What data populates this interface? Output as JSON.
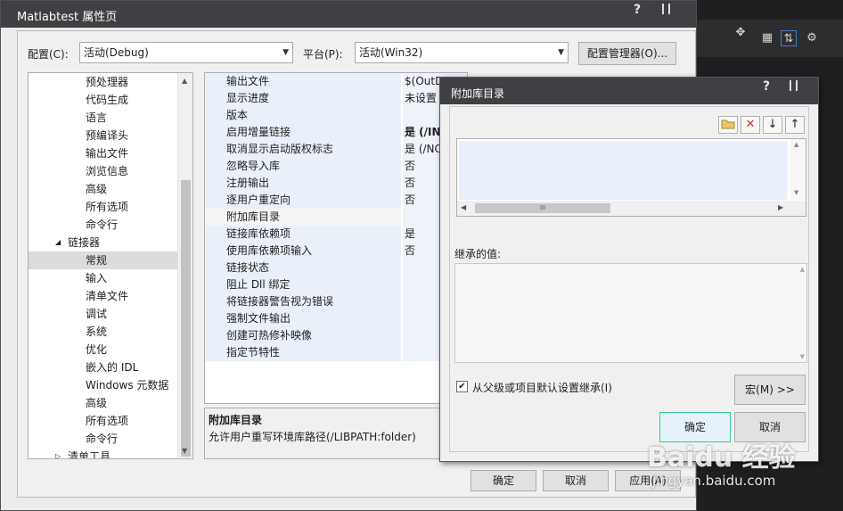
{
  "main_window": {
    "title": "Matlabtest 属性页",
    "help_glyph": "?",
    "config_label": "配置(C):",
    "config_value": "活动(Debug)",
    "platform_label": "平台(P):",
    "platform_value": "活动(Win32)",
    "config_manager_button": "配置管理器(O)...",
    "ok_button": "确定",
    "cancel_button": "取消",
    "apply_button": "应用(A)"
  },
  "tree": {
    "items": [
      {
        "label": "预处理器"
      },
      {
        "label": "代码生成"
      },
      {
        "label": "语言"
      },
      {
        "label": "预编译头"
      },
      {
        "label": "输出文件"
      },
      {
        "label": "浏览信息"
      },
      {
        "label": "高级"
      },
      {
        "label": "所有选项"
      },
      {
        "label": "命令行"
      },
      {
        "label": "链接器",
        "expander": "◢"
      },
      {
        "label": "常规"
      },
      {
        "label": "输入"
      },
      {
        "label": "清单文件"
      },
      {
        "label": "调试"
      },
      {
        "label": "系统"
      },
      {
        "label": "优化"
      },
      {
        "label": "嵌入的 IDL"
      },
      {
        "label": "Windows 元数据"
      },
      {
        "label": "高级"
      },
      {
        "label": "所有选项"
      },
      {
        "label": "命令行"
      },
      {
        "label": "清单工具",
        "expander": "▷"
      }
    ]
  },
  "grid": {
    "rows": [
      {
        "name": "输出文件",
        "value": "$(OutD"
      },
      {
        "name": "显示进度",
        "value": "未设置"
      },
      {
        "name": "版本",
        "value": ""
      },
      {
        "name": "启用增量链接",
        "value": "是 (/IN"
      },
      {
        "name": "取消显示启动版权标志",
        "value": "是 (/NC"
      },
      {
        "name": "忽略导入库",
        "value": "否"
      },
      {
        "name": "注册输出",
        "value": "否"
      },
      {
        "name": "逐用户重定向",
        "value": "否"
      },
      {
        "name": "附加库目录",
        "value": ""
      },
      {
        "name": "链接库依赖项",
        "value": "是"
      },
      {
        "name": "使用库依赖项输入",
        "value": "否"
      },
      {
        "name": "链接状态",
        "value": ""
      },
      {
        "name": "阻止 Dll 绑定",
        "value": ""
      },
      {
        "name": "将链接器警告视为错误",
        "value": ""
      },
      {
        "name": "强制文件输出",
        "value": ""
      },
      {
        "name": "创建可热修补映像",
        "value": ""
      },
      {
        "name": "指定节特性",
        "value": ""
      }
    ],
    "description_title": "附加库目录",
    "description_text": "允许用户重写环境库路径(/LIBPATH:folder)"
  },
  "sub_dialog": {
    "title": "附加库目录",
    "help_glyph": "?",
    "scroll_grip": "III",
    "inherited_label": "继承的值:",
    "inherit_checkbox_label": "从父级或项目默认设置继承(I)",
    "inherit_checked": true,
    "macros_button": "宏(M) >>",
    "ok_button": "确定",
    "cancel_button": "取消"
  },
  "watermark": {
    "logo_text": "Baidu 经验",
    "url": "jingyan.baidu.com"
  },
  "colors": {
    "titlebar": "#404044",
    "grid_name_bg": "#eaf0f9",
    "selected_tree_item": "#dcdcdc",
    "delete_icon": "#c0392b"
  }
}
